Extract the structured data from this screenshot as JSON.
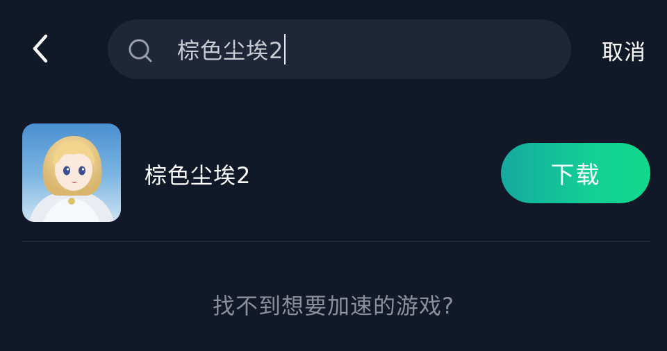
{
  "search": {
    "query": "棕色尘埃2",
    "cancel_label": "取消"
  },
  "results": [
    {
      "name": "棕色尘埃2",
      "button_label": "下载"
    }
  ],
  "footer": {
    "help_text": "找不到想要加速的游戏?"
  },
  "colors": {
    "background": "#111827",
    "search_bg": "#1f2637",
    "button_gradient_start": "#16a99f",
    "button_gradient_end": "#12d98c"
  },
  "icons": {
    "back": "chevron-left-icon",
    "search": "search-icon",
    "game": "game-app-icon"
  }
}
